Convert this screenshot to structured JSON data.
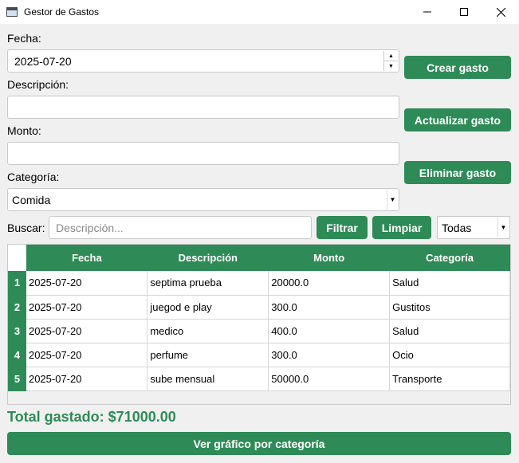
{
  "window": {
    "title": "Gestor de Gastos",
    "minimize": "—",
    "maximize": "☐",
    "close": "✕"
  },
  "form": {
    "fecha_label": "Fecha:",
    "fecha_value": "2025-07-20",
    "descripcion_label": "Descripción:",
    "descripcion_value": "",
    "monto_label": "Monto:",
    "monto_value": "",
    "categoria_label": "Categoría:",
    "categoria_value": "Comida"
  },
  "actions": {
    "crear": "Crear gasto",
    "actualizar": "Actualizar gasto",
    "eliminar": "Eliminar gasto"
  },
  "search": {
    "label": "Buscar:",
    "placeholder": "Descripción...",
    "value": "",
    "filtrar": "Filtrar",
    "limpiar": "Limpiar",
    "filter_value": "Todas"
  },
  "table": {
    "headers": [
      "Fecha",
      "Descripción",
      "Monto",
      "Categoría"
    ],
    "rows": [
      {
        "index": "1",
        "fecha": "2025-07-20",
        "descripcion": "septima prueba",
        "monto": "20000.0",
        "categoria": "Salud"
      },
      {
        "index": "2",
        "fecha": "2025-07-20",
        "descripcion": "juegod e play",
        "monto": "300.0",
        "categoria": "Gustitos"
      },
      {
        "index": "3",
        "fecha": "2025-07-20",
        "descripcion": "medico",
        "monto": "400.0",
        "categoria": "Salud"
      },
      {
        "index": "4",
        "fecha": "2025-07-20",
        "descripcion": "perfume",
        "monto": "300.0",
        "categoria": "Ocio"
      },
      {
        "index": "5",
        "fecha": "2025-07-20",
        "descripcion": "sube mensual",
        "monto": "50000.0",
        "categoria": "Transporte"
      }
    ]
  },
  "summary": {
    "total": "Total gastado: $71000.00",
    "chart_button": "Ver gráfico por categoría"
  },
  "colors": {
    "accent": "#2e8b57",
    "background": "#f0f0f0"
  }
}
